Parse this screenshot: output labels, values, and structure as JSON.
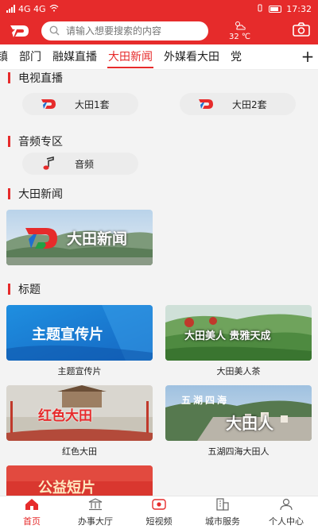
{
  "status_bar": {
    "left_text": "4G  4G",
    "time": "17:32"
  },
  "header": {
    "search_placeholder": "请输入想要搜索的内容",
    "temperature": "32 ℃"
  },
  "tabs": [
    "镇",
    "部门",
    "融媒直播",
    "大田新闻",
    "外媒看大田",
    "党"
  ],
  "sections": {
    "tv": {
      "title": "电视直播",
      "items": [
        "大田1套",
        "大田2套"
      ]
    },
    "audio": {
      "title": "音频专区",
      "items": [
        "音频"
      ]
    },
    "news": {
      "title": "大田新闻",
      "banner_text": "大田新闻"
    },
    "topics": {
      "title": "标题",
      "items": [
        {
          "caption": "主题宣传片",
          "overlay": "主题宣传片"
        },
        {
          "caption": "大田美人茶",
          "overlay": "大田美人 贵雅天成"
        },
        {
          "caption": "红色大田",
          "overlay": "红色大田"
        },
        {
          "caption": "五湖四海大田人",
          "overlay_top": "五湖四海",
          "overlay": "大田人"
        },
        {
          "overlay": "公益短片"
        }
      ]
    }
  },
  "bottom_nav": [
    "首页",
    "办事大厅",
    "短视频",
    "城市服务",
    "个人中心"
  ],
  "colors": {
    "accent": "#e62b2b"
  }
}
